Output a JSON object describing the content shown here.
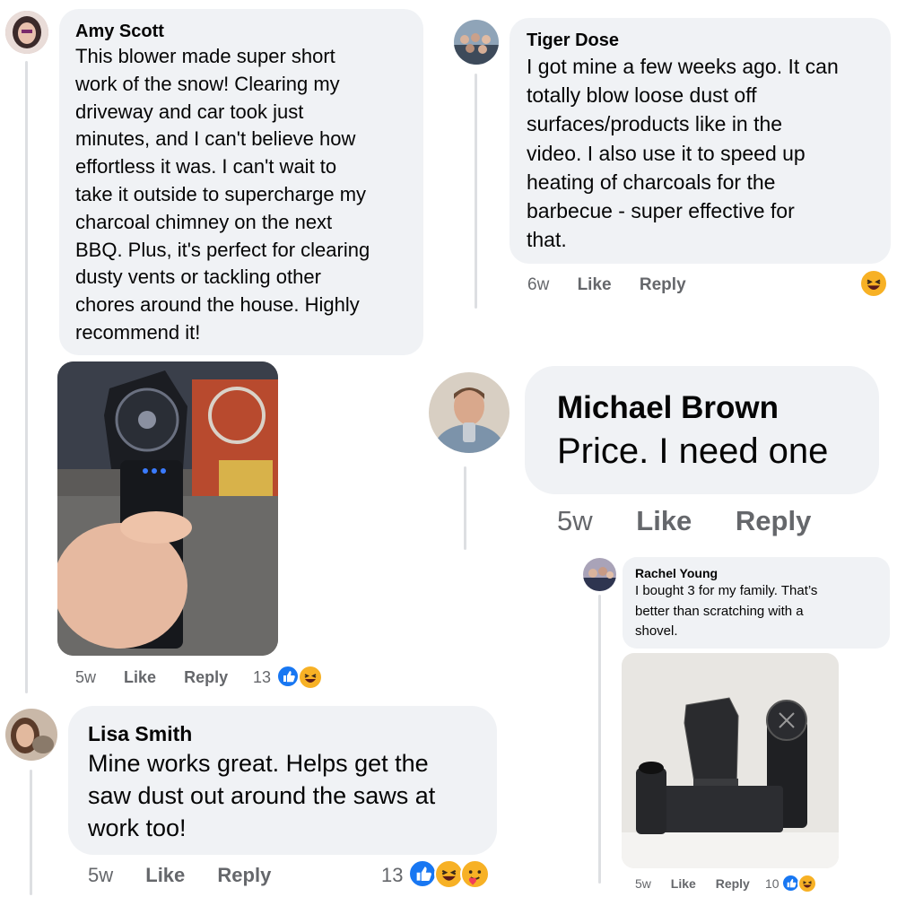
{
  "comments": {
    "amy": {
      "name": "Amy Scott",
      "lines": [
        "This blower made super short",
        "work of the snow! Clearing my",
        "driveway and car took just",
        "minutes, and I can't believe how",
        "effortless it was. I can't wait to",
        "take it outside to supercharge my",
        "charcoal chimney on the next",
        "BBQ. Plus, it's perfect for clearing",
        "dusty vents or tackling other",
        "chores around the house. Highly",
        "recommend it!"
      ],
      "time": "5w",
      "like": "Like",
      "reply": "Reply",
      "reactions": "13"
    },
    "tiger": {
      "name": "Tiger Dose",
      "lines": [
        "I got mine a few weeks ago. It can",
        "totally blow loose dust off",
        "surfaces/products like in the",
        "video. I also use it to speed up",
        "heating of charcoals for the",
        "barbecue - super effective for",
        "that."
      ],
      "time": "6w",
      "like": "Like",
      "reply": "Reply"
    },
    "michael": {
      "name": "Michael Brown",
      "text": "Price. I need one",
      "time": "5w",
      "like": "Like",
      "reply": "Reply"
    },
    "rachel": {
      "name": "Rachel Young",
      "lines": [
        "I bought 3 for my family. That’s",
        "better than scratching with a",
        "shovel."
      ],
      "time": "5w",
      "like": "Like",
      "reply": "Reply",
      "reactions": "10"
    },
    "lisa": {
      "name": "Lisa Smith",
      "lines": [
        "Mine works great. Helps get the",
        "saw dust out around the saws at",
        "work too!"
      ],
      "time": "5w",
      "like": "Like",
      "reply": "Reply",
      "reactions": "13"
    }
  },
  "colors": {
    "bubble": "#f0f2f5",
    "meta": "#65676b",
    "like": "#1877f2",
    "emoji": "#f7b125"
  }
}
